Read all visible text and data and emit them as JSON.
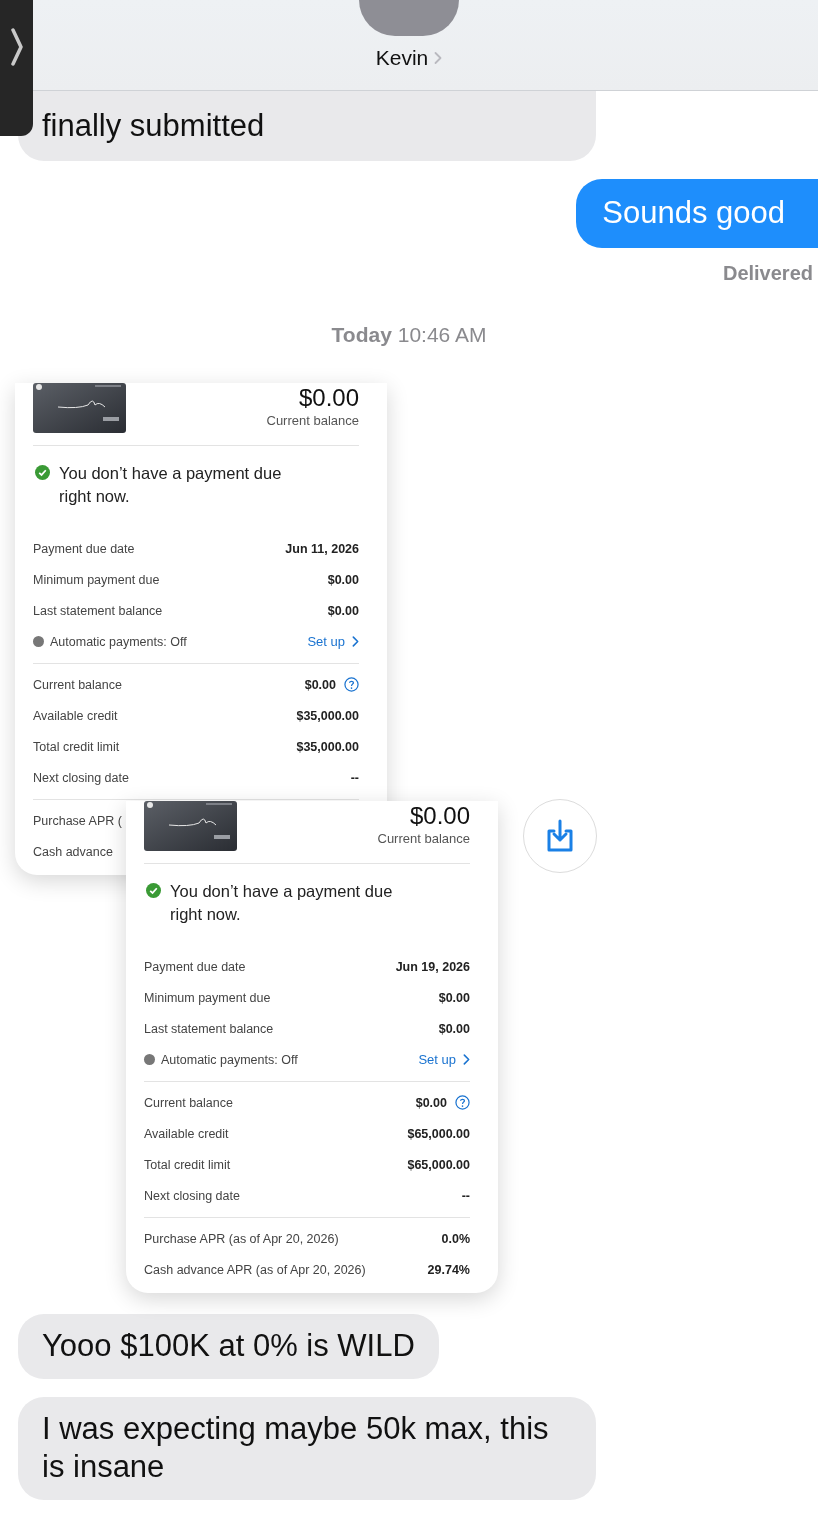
{
  "header": {
    "contact": "Kevin"
  },
  "messages": [
    {
      "kind": "incoming",
      "text": "finally submitted"
    },
    {
      "kind": "outgoing",
      "text": "Sounds good",
      "status": "Delivered"
    },
    {
      "kind": "timestamp",
      "day": "Today",
      "time": "10:46 AM"
    },
    {
      "kind": "images",
      "cards": [
        {
          "balance": "$0.00",
          "balance_label": "Current balance",
          "notice": "You don’t have a payment due right now.",
          "sections": [
            [
              {
                "kind": "value",
                "label": "Payment due date",
                "value": "Jun 11, 2026"
              },
              {
                "kind": "value",
                "label": "Minimum payment due",
                "value": "$0.00"
              },
              {
                "kind": "value",
                "label": "Last statement balance",
                "value": "$0.00"
              },
              {
                "kind": "autopay",
                "label": "Automatic payments: Off",
                "action": "Set up"
              }
            ],
            [
              {
                "kind": "help",
                "label": "Current balance",
                "value": "$0.00"
              },
              {
                "kind": "value",
                "label": "Available credit",
                "value": "$35,000.00"
              },
              {
                "kind": "value",
                "label": "Total credit limit",
                "value": "$35,000.00"
              },
              {
                "kind": "value",
                "label": "Next closing date",
                "value": "--"
              }
            ],
            [
              {
                "kind": "value",
                "label": "Purchase APR ("
              },
              {
                "kind": "value",
                "label": "Cash advance"
              }
            ]
          ]
        },
        {
          "balance": "$0.00",
          "balance_label": "Current balance",
          "notice": "You don’t have a payment due right now.",
          "sections": [
            [
              {
                "kind": "value",
                "label": "Payment due date",
                "value": "Jun 19, 2026"
              },
              {
                "kind": "value",
                "label": "Minimum payment due",
                "value": "$0.00"
              },
              {
                "kind": "value",
                "label": "Last statement balance",
                "value": "$0.00"
              },
              {
                "kind": "autopay",
                "label": "Automatic payments: Off",
                "action": "Set up"
              }
            ],
            [
              {
                "kind": "help",
                "label": "Current balance",
                "value": "$0.00"
              },
              {
                "kind": "value",
                "label": "Available credit",
                "value": "$65,000.00"
              },
              {
                "kind": "value",
                "label": "Total credit limit",
                "value": "$65,000.00"
              },
              {
                "kind": "value",
                "label": "Next closing date",
                "value": "--"
              }
            ],
            [
              {
                "kind": "value",
                "label": "Purchase APR (as of Apr 20, 2026)",
                "value": "0.0%"
              },
              {
                "kind": "value",
                "label": "Cash advance APR (as of Apr 20, 2026)",
                "value": "29.74%"
              }
            ]
          ]
        }
      ]
    },
    {
      "kind": "incoming",
      "text": "Yooo $100K at 0% is WILD"
    },
    {
      "kind": "incoming",
      "text": "I was expecting maybe 50k max, this is insane"
    }
  ]
}
